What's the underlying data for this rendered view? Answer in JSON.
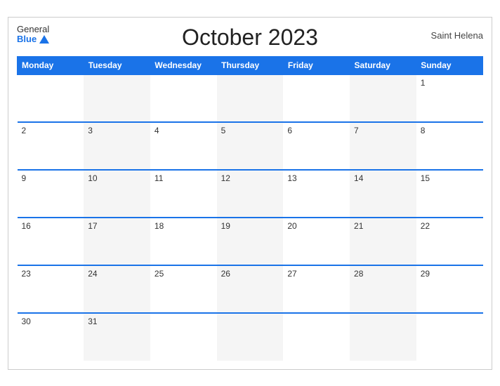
{
  "header": {
    "title": "October 2023",
    "region": "Saint Helena",
    "logo_general": "General",
    "logo_blue": "Blue"
  },
  "weekdays": [
    "Monday",
    "Tuesday",
    "Wednesday",
    "Thursday",
    "Friday",
    "Saturday",
    "Sunday"
  ],
  "weeks": [
    [
      "",
      "",
      "",
      "",
      "",
      "",
      "1"
    ],
    [
      "2",
      "3",
      "4",
      "5",
      "6",
      "7",
      "8"
    ],
    [
      "9",
      "10",
      "11",
      "12",
      "13",
      "14",
      "15"
    ],
    [
      "16",
      "17",
      "18",
      "19",
      "20",
      "21",
      "22"
    ],
    [
      "23",
      "24",
      "25",
      "26",
      "27",
      "28",
      "29"
    ],
    [
      "30",
      "31",
      "",
      "",
      "",
      "",
      ""
    ]
  ]
}
